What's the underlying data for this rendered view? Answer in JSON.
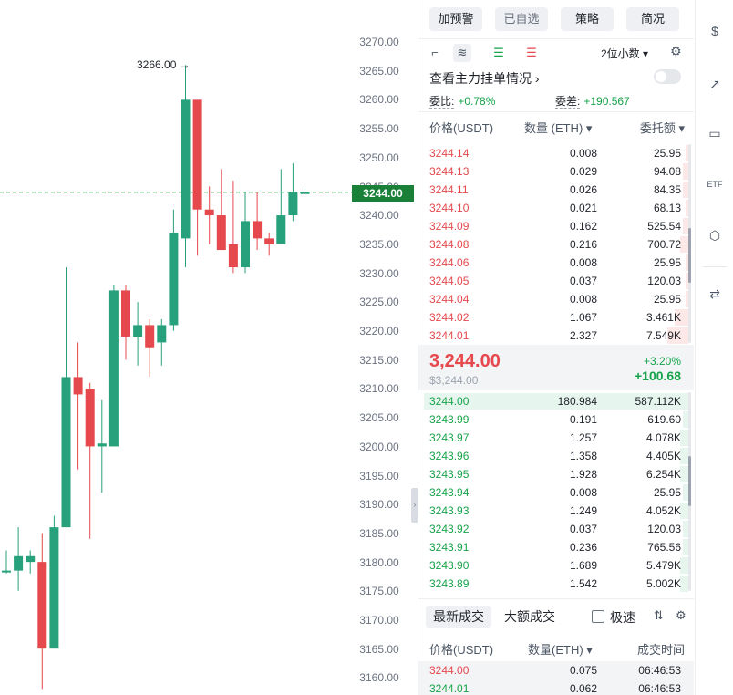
{
  "chart": {
    "y_ticks": [
      "3270.00",
      "3265.00",
      "3260.00",
      "3255.00",
      "3250.00",
      "3245.00",
      "3240.00",
      "3235.00",
      "3230.00",
      "3225.00",
      "3220.00",
      "3215.00",
      "3210.00",
      "3205.00",
      "3200.00",
      "3195.00",
      "3190.00",
      "3185.00",
      "3180.00",
      "3175.00",
      "3170.00",
      "3165.00",
      "3160.00"
    ],
    "high_label": "3266.00",
    "last_price": "3244.00",
    "colors": {
      "up": "#26a17b",
      "down": "#e5484d",
      "last_line": "#1a7f37"
    },
    "candles": [
      {
        "o": 3178.5,
        "h": 3182,
        "l": 3178,
        "c": 3178.5
      },
      {
        "o": 3178.5,
        "h": 3186,
        "l": 3175,
        "c": 3181
      },
      {
        "o": 3180,
        "h": 3182,
        "l": 3178,
        "c": 3181
      },
      {
        "o": 3180,
        "h": 3185,
        "l": 3158,
        "c": 3165
      },
      {
        "o": 3165,
        "h": 3188,
        "l": 3165,
        "c": 3186
      },
      {
        "o": 3186,
        "h": 3231,
        "l": 3186,
        "c": 3212
      },
      {
        "o": 3212,
        "h": 3218,
        "l": 3196,
        "c": 3209
      },
      {
        "o": 3210,
        "h": 3211,
        "l": 3184,
        "c": 3200
      },
      {
        "o": 3200,
        "h": 3208,
        "l": 3192,
        "c": 3200.5
      },
      {
        "o": 3200,
        "h": 3228,
        "l": 3200,
        "c": 3227
      },
      {
        "o": 3227,
        "h": 3228,
        "l": 3215,
        "c": 3219
      },
      {
        "o": 3219,
        "h": 3225,
        "l": 3214,
        "c": 3221
      },
      {
        "o": 3221,
        "h": 3222,
        "l": 3212,
        "c": 3217
      },
      {
        "o": 3218,
        "h": 3222,
        "l": 3214,
        "c": 3221
      },
      {
        "o": 3221,
        "h": 3241,
        "l": 3220,
        "c": 3237
      },
      {
        "o": 3236,
        "h": 3266,
        "l": 3231,
        "c": 3260
      },
      {
        "o": 3260,
        "h": 3260,
        "l": 3233,
        "c": 3241
      },
      {
        "o": 3241,
        "h": 3245,
        "l": 3235,
        "c": 3240
      },
      {
        "o": 3240,
        "h": 3248,
        "l": 3234,
        "c": 3234
      },
      {
        "o": 3235,
        "h": 3246,
        "l": 3230,
        "c": 3231
      },
      {
        "o": 3231,
        "h": 3244,
        "l": 3230,
        "c": 3239
      },
      {
        "o": 3239,
        "h": 3244,
        "l": 3234,
        "c": 3236
      },
      {
        "o": 3236,
        "h": 3237,
        "l": 3233,
        "c": 3235
      },
      {
        "o": 3235,
        "h": 3248,
        "l": 3235,
        "c": 3240
      },
      {
        "o": 3240,
        "h": 3249,
        "l": 3239,
        "c": 3244
      },
      {
        "o": 3244,
        "h": 3244.5,
        "l": 3243.5,
        "c": 3244
      }
    ]
  },
  "top_buttons": [
    "加预警",
    "已自选",
    "策略",
    "简况"
  ],
  "precision": "2位小数 ▾",
  "depth_link": "查看主力挂单情况 ›",
  "ratio": {
    "label": "委比:",
    "value": "+0.78%"
  },
  "diff": {
    "label": "委差:",
    "value": "+190.567"
  },
  "book_headers": {
    "price": "价格(USDT)",
    "qty": "数量 (ETH) ▾",
    "total": "委托额 ▾"
  },
  "asks": [
    {
      "p": "3244.14",
      "q": "0.008",
      "t": "25.95",
      "d": 0.01
    },
    {
      "p": "3244.13",
      "q": "0.029",
      "t": "94.08",
      "d": 0.02
    },
    {
      "p": "3244.11",
      "q": "0.026",
      "t": "84.35",
      "d": 0.02
    },
    {
      "p": "3244.10",
      "q": "0.021",
      "t": "68.13",
      "d": 0.01
    },
    {
      "p": "3244.09",
      "q": "0.162",
      "t": "525.54",
      "d": 0.02
    },
    {
      "p": "3244.08",
      "q": "0.216",
      "t": "700.72",
      "d": 0.03
    },
    {
      "p": "3244.06",
      "q": "0.008",
      "t": "25.95",
      "d": 0.01
    },
    {
      "p": "3244.05",
      "q": "0.037",
      "t": "120.03",
      "d": 0.01
    },
    {
      "p": "3244.04",
      "q": "0.008",
      "t": "25.95",
      "d": 0.01
    },
    {
      "p": "3244.02",
      "q": "1.067",
      "t": "3.461K",
      "d": 0.05
    },
    {
      "p": "3244.01",
      "q": "2.327",
      "t": "7.549K",
      "d": 0.08
    }
  ],
  "mid": {
    "price": "3,244.00",
    "usd": "$3,244.00",
    "pct": "+3.20%",
    "change": "+100.68"
  },
  "bids": [
    {
      "p": "3244.00",
      "q": "180.984",
      "t": "587.112K",
      "d": 1.0
    },
    {
      "p": "3243.99",
      "q": "0.191",
      "t": "619.60",
      "d": 0.02
    },
    {
      "p": "3243.97",
      "q": "1.257",
      "t": "4.078K",
      "d": 0.03
    },
    {
      "p": "3243.96",
      "q": "1.358",
      "t": "4.405K",
      "d": 0.03
    },
    {
      "p": "3243.95",
      "q": "1.928",
      "t": "6.254K",
      "d": 0.03
    },
    {
      "p": "3243.94",
      "q": "0.008",
      "t": "25.95",
      "d": 0.02
    },
    {
      "p": "3243.93",
      "q": "1.249",
      "t": "4.052K",
      "d": 0.03
    },
    {
      "p": "3243.92",
      "q": "0.037",
      "t": "120.03",
      "d": 0.02
    },
    {
      "p": "3243.91",
      "q": "0.236",
      "t": "765.56",
      "d": 0.02
    },
    {
      "p": "3243.90",
      "q": "1.689",
      "t": "5.479K",
      "d": 0.03
    },
    {
      "p": "3243.89",
      "q": "1.542",
      "t": "5.002K",
      "d": 0.03
    }
  ],
  "trade_tabs": {
    "latest": "最新成交",
    "large": "大额成交",
    "speed": "极速"
  },
  "trade_headers": {
    "price": "价格(USDT)",
    "qty": "数量(ETH) ▾",
    "time": "成交时间"
  },
  "trades": [
    {
      "p": "3244.00",
      "q": "0.075",
      "t": "06:46:53",
      "side": "sell"
    },
    {
      "p": "3244.01",
      "q": "0.062",
      "t": "06:46:53",
      "side": "buy"
    }
  ],
  "rail_icons": [
    "dollar-doc-icon",
    "trend-chart-icon",
    "monitor-icon",
    "etf-icon",
    "hexagon-token-icon",
    "swap-icon"
  ]
}
